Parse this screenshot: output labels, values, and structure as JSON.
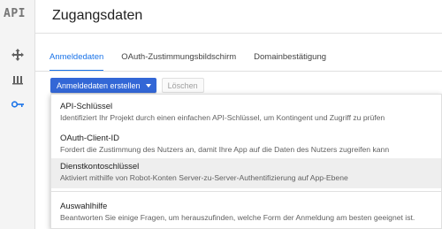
{
  "app": {
    "logo": "API"
  },
  "sidebar": {
    "icons": [
      "move-icon",
      "dashboard-icon",
      "key-icon"
    ]
  },
  "header": {
    "title": "Zugangsdaten"
  },
  "tabs": [
    {
      "label": "Anmeldedaten",
      "active": true
    },
    {
      "label": "OAuth-Zustimmungsbildschirm",
      "active": false
    },
    {
      "label": "Domainbestätigung",
      "active": false
    }
  ],
  "toolbar": {
    "create_label": "Anmeldedaten erstellen",
    "delete_label": "Löschen"
  },
  "menu": {
    "items": [
      {
        "title": "API-Schlüssel",
        "desc": "Identifiziert Ihr Projekt durch einen einfachen API-Schlüssel, um Kontingent und Zugriff zu prüfen",
        "highlighted": false
      },
      {
        "title": "OAuth-Client-ID",
        "desc": "Fordert die Zustimmung des Nutzers an, damit Ihre App auf die Daten des Nutzers zugreifen kann",
        "highlighted": false
      },
      {
        "title": "Dienstkontoschlüssel",
        "desc": "Aktiviert mithilfe von Robot-Konten Server-zu-Server-Authentifizierung auf App-Ebene",
        "highlighted": true
      },
      {
        "title": "Auswahlhilfe",
        "desc": "Beantworten Sie einige Fragen, um herauszufinden, welche Form der Anmeldung am besten geeignet ist.",
        "highlighted": false
      }
    ]
  },
  "colors": {
    "accent": "#1a73e8",
    "button": "#3367d6",
    "highlight": "#eeeeee"
  }
}
